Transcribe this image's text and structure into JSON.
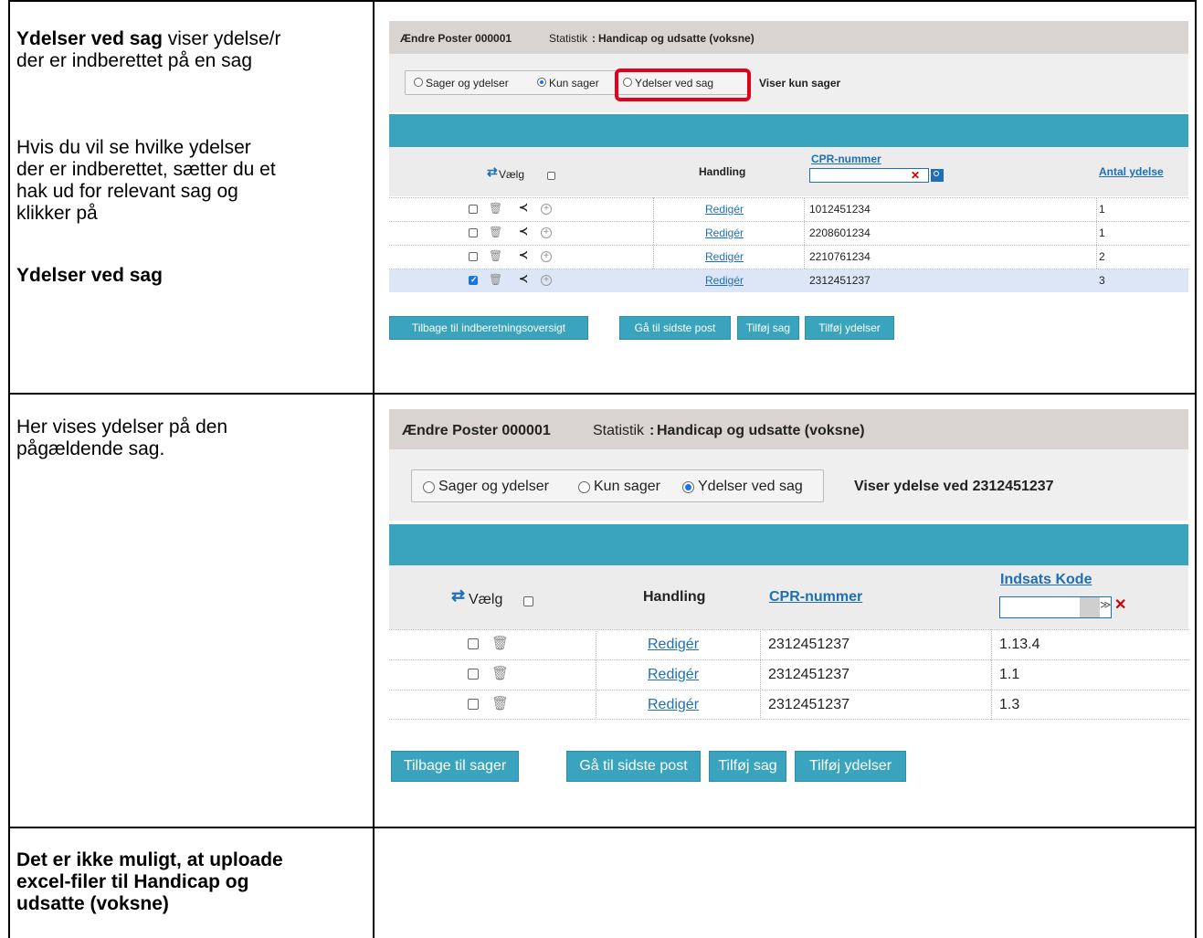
{
  "left_col": {
    "row1": {
      "bold_lead": "Ydelser ved sag",
      "line1_rest": " viser ydelse/r",
      "line2": "der er indberettet på en sag",
      "p2_line1": "Hvis du vil se hvilke ydelser",
      "p2_line2": "der er indberettet, sætter du et",
      "p2_line3": "hak ud for relevant sag og",
      "p2_line4": "klikker på",
      "bold_end": "Ydelser ved sag"
    },
    "row2": {
      "line1": "Her vises ydelser på den",
      "line2": "pågældende sag."
    },
    "row3": {
      "line1": "Det er ikke muligt, at uploade",
      "line2": "excel-filer til Handicap og",
      "line3": "udsatte (voksne)"
    }
  },
  "shot1": {
    "title_bold": "Ændre Poster 000001",
    "title_label": "Statistik",
    "title_colon": ":",
    "title_value": "Handicap og udsatte (voksne)",
    "radio_options": [
      "Sager og ydelser",
      "Kun sager",
      "Ydelser ved sag"
    ],
    "selected": "Kun sager",
    "status": "Viser kun sager",
    "headers": {
      "select": "Vælg",
      "action": "Handling",
      "cpr": "CPR-nummer",
      "count": "Antal ydelse"
    },
    "clear_icon": "✕",
    "rows": [
      {
        "action": "Redigér",
        "cpr": "1012451234",
        "count": "1",
        "checked": false
      },
      {
        "action": "Redigér",
        "cpr": "2208601234",
        "count": "1",
        "checked": false
      },
      {
        "action": "Redigér",
        "cpr": "2210761234",
        "count": "2",
        "checked": false
      },
      {
        "action": "Redigér",
        "cpr": "2312451237",
        "count": "3",
        "checked": true
      }
    ],
    "buttons": {
      "back": "Tilbage til indberetningsoversigt",
      "last": "Gå til sidste post",
      "add_case": "Tilføj sag",
      "add_ydelser": "Tilføj ydelser"
    },
    "highlight_color": "#e2001a"
  },
  "shot2": {
    "title_bold": "Ændre Poster 000001",
    "title_label": "Statistik",
    "title_colon": ":",
    "title_value": "Handicap og udsatte (voksne)",
    "radio_options": [
      "Sager og ydelser",
      "Kun sager",
      "Ydelser ved sag"
    ],
    "selected": "Ydelser ved sag",
    "status": "Viser ydelse ved 2312451237",
    "headers": {
      "select": "Vælg",
      "action": "Handling",
      "cpr": "CPR-nummer",
      "code": "Indsats Kode"
    },
    "clear_icon": "✕",
    "dropdown_icon": "≫",
    "rows": [
      {
        "action": "Redigér",
        "cpr": "2312451237",
        "code": "1.13.4"
      },
      {
        "action": "Redigér",
        "cpr": "2312451237",
        "code": "1.1"
      },
      {
        "action": "Redigér",
        "cpr": "2312451237",
        "code": "1.3"
      }
    ],
    "buttons": {
      "back": "Tilbage til sager",
      "last": "Gå til sidste post",
      "add_case": "Tilføj sag",
      "add_ydelser": "Tilføj ydelser"
    }
  }
}
